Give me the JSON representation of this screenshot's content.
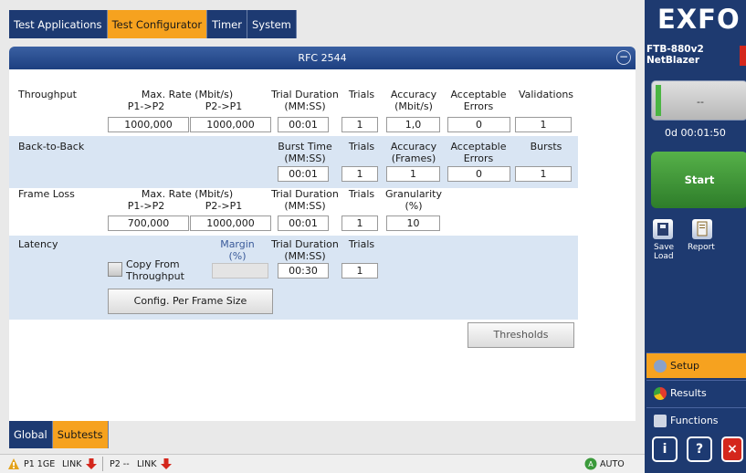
{
  "top_tabs": [
    {
      "label": "Test Applications"
    },
    {
      "label": "Test Configurator"
    },
    {
      "label": "Timer"
    },
    {
      "label": "System"
    }
  ],
  "panel": {
    "title": "RFC 2544"
  },
  "throughput": {
    "label": "Throughput",
    "max_rate_header": "Max. Rate (Mbit/s)",
    "p1p2_header": "P1->P2",
    "p2p1_header": "P2->P1",
    "trial_duration_header": "Trial Duration",
    "trial_duration_unit": "(MM:SS)",
    "trials_header": "Trials",
    "accuracy_header": "Accuracy",
    "accuracy_unit": "(Mbit/s)",
    "acceptable_header": "Acceptable",
    "errors_header": "Errors",
    "validations_header": "Validations",
    "p1p2": "1000,000",
    "p2p1": "1000,000",
    "trial_duration": "00:01",
    "trials": "1",
    "accuracy": "1,0",
    "acceptable_errors": "0",
    "validations": "1"
  },
  "back_to_back": {
    "label": "Back-to-Back",
    "burst_time_header": "Burst Time",
    "burst_time_unit": "(MM:SS)",
    "trials_header": "Trials",
    "accuracy_header": "Accuracy",
    "accuracy_unit": "(Frames)",
    "acceptable_header": "Acceptable",
    "errors_header": "Errors",
    "bursts_header": "Bursts",
    "burst_time": "00:01",
    "trials": "1",
    "accuracy": "1",
    "acceptable_errors": "0",
    "bursts": "1"
  },
  "frame_loss": {
    "label": "Frame Loss",
    "max_rate_header": "Max. Rate (Mbit/s)",
    "p1p2_header": "P1->P2",
    "p2p1_header": "P2->P1",
    "trial_duration_header": "Trial Duration",
    "trial_duration_unit": "(MM:SS)",
    "trials_header": "Trials",
    "granularity_header": "Granularity",
    "granularity_unit": "(%)",
    "p1p2": "700,000",
    "p2p1": "1000,000",
    "trial_duration": "00:01",
    "trials": "1",
    "granularity": "10"
  },
  "latency": {
    "label": "Latency",
    "margin_header": "Margin",
    "margin_unit": "(%)",
    "trial_duration_header": "Trial Duration",
    "trial_duration_unit": "(MM:SS)",
    "trials_header": "Trials",
    "copy_from_line1": "Copy From",
    "copy_from_line2": "Throughput",
    "margin": "",
    "trial_duration": "00:30",
    "trials": "1",
    "config_button": "Config. Per Frame Size"
  },
  "thresholds_button": "Thresholds",
  "bottom_tabs": [
    {
      "label": "Global"
    },
    {
      "label": "Subtests"
    }
  ],
  "status": {
    "p1": "P1 1GE",
    "p1_link": "LINK",
    "p2": "P2 --",
    "p2_link": "LINK",
    "auto": "AUTO"
  },
  "side": {
    "logo": "EXFO",
    "device_line1": "FTB-880v2",
    "device_line2": "NetBlazer",
    "progress_text": "--",
    "timer": "0d 00:01:50",
    "start": "Start",
    "save_label1": "Save",
    "save_label2": "Load",
    "report_label": "Report",
    "nav": [
      {
        "label": "Setup"
      },
      {
        "label": "Results"
      },
      {
        "label": "Functions"
      }
    ]
  },
  "colors": {
    "accent": "#f6a21f",
    "navy": "#1d3a72",
    "band": "#d9e5f3",
    "start": "#3f9a38"
  }
}
